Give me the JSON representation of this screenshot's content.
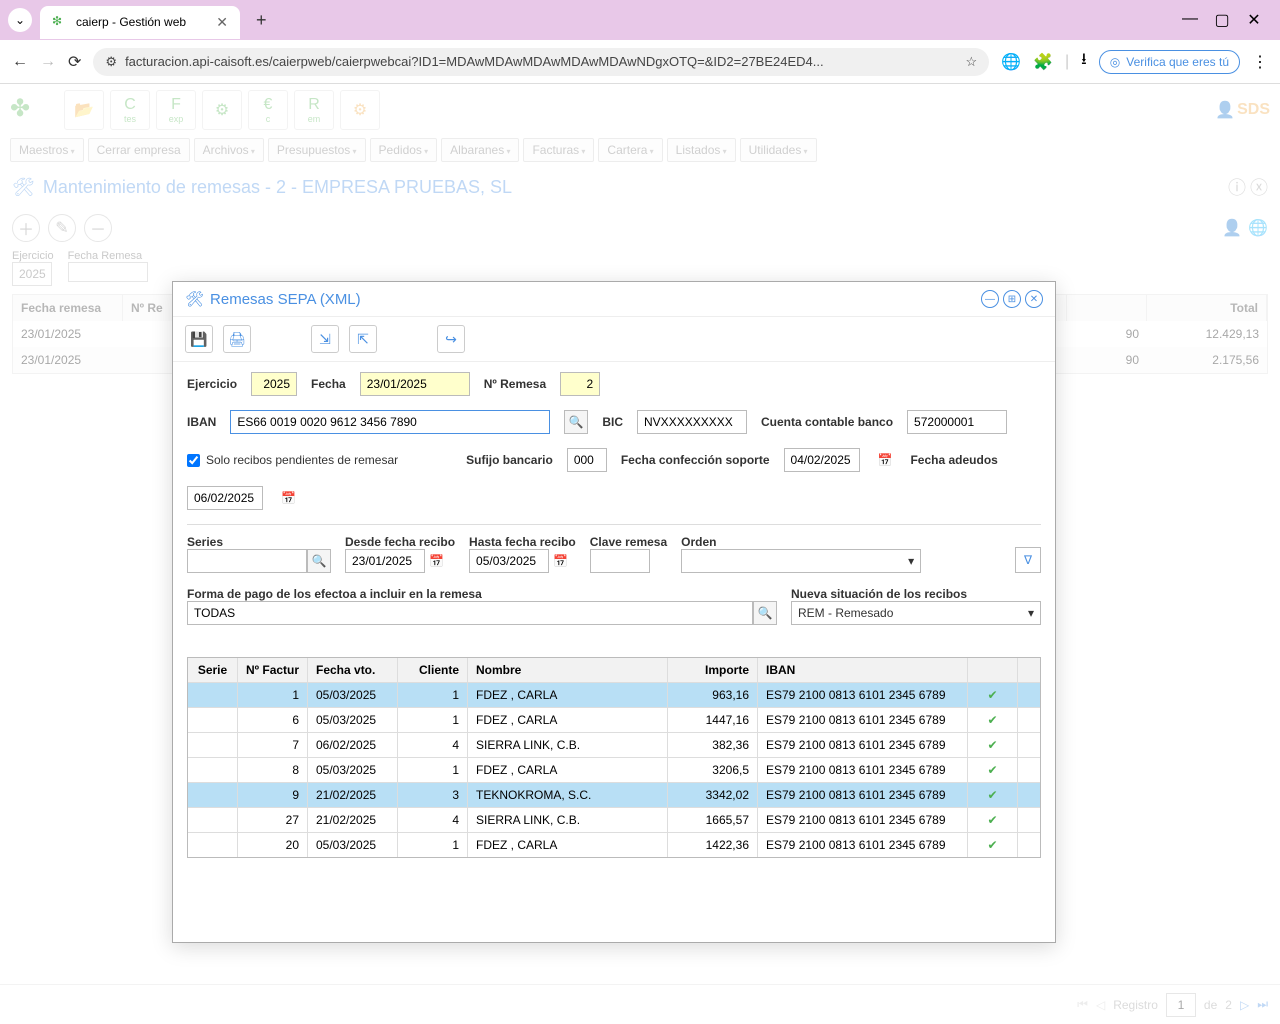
{
  "browser": {
    "tab_title": "caierp - Gestión web",
    "url": "facturacion.api-caisoft.es/caierpweb/caierpwebcai?ID1=MDAwMDAwMDAwMDAwMDAwNDgxOTQ=&ID2=27BE24ED4...",
    "verify_text": "Verifica que eres tú"
  },
  "app_menu": [
    "Maestros",
    "Cerrar empresa",
    "Archivos",
    "Presupuestos",
    "Pedidos",
    "Albaranes",
    "Facturas",
    "Cartera",
    "Listados",
    "Utilidades"
  ],
  "page_title": "Mantenimiento de remesas - 2 - EMPRESA PRUEBAS, SL",
  "bg_filter": {
    "ejercicio_label": "Ejercicio",
    "ejercicio_value": "2025",
    "fecha_label": "Fecha Remesa"
  },
  "bg_table": {
    "headers": {
      "fecha": "Fecha remesa",
      "nrem": "Nº Re",
      "total": "Total"
    },
    "rows": [
      {
        "fecha": "23/01/2025",
        "num": "90",
        "total": "12.429,13"
      },
      {
        "fecha": "23/01/2025",
        "num": "90",
        "total": "2.175,56"
      }
    ]
  },
  "modal": {
    "title": "Remesas SEPA (XML)",
    "row1": {
      "ejercicio_label": "Ejercicio",
      "ejercicio_value": "2025",
      "fecha_label": "Fecha",
      "fecha_value": "23/01/2025",
      "nremesa_label": "Nº Remesa",
      "nremesa_value": "2"
    },
    "row2": {
      "iban_label": "IBAN",
      "iban_value": "ES66 0019 0020 9612 3456 7890",
      "bic_label": "BIC",
      "bic_value": "NVXXXXXXXXX",
      "cuenta_label": "Cuenta contable banco",
      "cuenta_value": "572000001"
    },
    "row3": {
      "checkbox_label": "Solo recibos pendientes de remesar",
      "sufijo_label": "Sufijo bancario",
      "sufijo_value": "000",
      "fconf_label": "Fecha confección soporte",
      "fconf_value": "04/02/2025",
      "fadeu_label": "Fecha adeudos",
      "fadeu_value": "06/02/2025"
    },
    "row4": {
      "series_label": "Series",
      "desde_label": "Desde fecha recibo",
      "desde_value": "23/01/2025",
      "hasta_label": "Hasta fecha recibo",
      "hasta_value": "05/03/2025",
      "clave_label": "Clave remesa",
      "orden_label": "Orden"
    },
    "row5": {
      "forma_label": "Forma de pago de los efectoa a incluir en la remesa",
      "forma_value": "TODAS",
      "situ_label": "Nueva situación de los recibos",
      "situ_value": "REM - Remesado"
    },
    "table": {
      "headers": {
        "serie": "Serie",
        "factura": "Nº Factur",
        "fvto": "Fecha vto.",
        "cliente": "Cliente",
        "nombre": "Nombre",
        "importe": "Importe",
        "iban": "IBAN"
      },
      "rows": [
        {
          "serie": "",
          "factura": "1",
          "fvto": "05/03/2025",
          "cliente": "1",
          "nombre": "FDEZ , CARLA",
          "importe": "963,16",
          "iban": "ES79 2100 0813 6101 2345 6789",
          "sel": true
        },
        {
          "serie": "",
          "factura": "6",
          "fvto": "05/03/2025",
          "cliente": "1",
          "nombre": "FDEZ , CARLA",
          "importe": "1447,16",
          "iban": "ES79 2100 0813 6101 2345 6789",
          "sel": false
        },
        {
          "serie": "",
          "factura": "7",
          "fvto": "06/02/2025",
          "cliente": "4",
          "nombre": "SIERRA LINK, C.B.",
          "importe": "382,36",
          "iban": "ES79 2100 0813 6101 2345 6789",
          "sel": false
        },
        {
          "serie": "",
          "factura": "8",
          "fvto": "05/03/2025",
          "cliente": "1",
          "nombre": "FDEZ , CARLA",
          "importe": "3206,5",
          "iban": "ES79 2100 0813 6101 2345 6789",
          "sel": false
        },
        {
          "serie": "",
          "factura": "9",
          "fvto": "21/02/2025",
          "cliente": "3",
          "nombre": "TEKNOKROMA, S.C.",
          "importe": "3342,02",
          "iban": "ES79 2100 0813 6101 2345 6789",
          "sel": true
        },
        {
          "serie": "",
          "factura": "27",
          "fvto": "21/02/2025",
          "cliente": "4",
          "nombre": "SIERRA LINK, C.B.",
          "importe": "1665,57",
          "iban": "ES79 2100 0813 6101 2345 6789",
          "sel": false
        },
        {
          "serie": "",
          "factura": "20",
          "fvto": "05/03/2025",
          "cliente": "1",
          "nombre": "FDEZ , CARLA",
          "importe": "1422,36",
          "iban": "ES79 2100 0813 6101 2345 6789",
          "sel": false
        }
      ]
    }
  },
  "bottom": {
    "registro_label": "Registro",
    "current": "1",
    "de": "de",
    "total": "2"
  },
  "sds": "SDS"
}
